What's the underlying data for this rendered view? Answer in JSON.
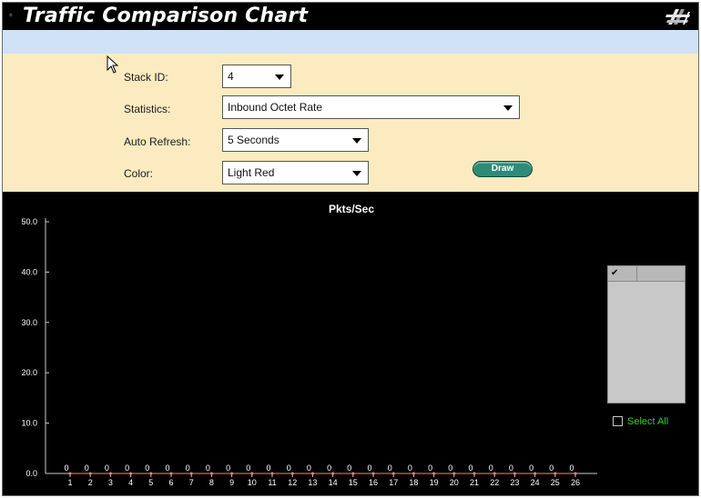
{
  "header": {
    "title": "Traffic Comparison Chart",
    "bullet": "◦",
    "logo_icon": "brand-logo-icon"
  },
  "controls": {
    "stack_id": {
      "label": "Stack ID:",
      "value": "4"
    },
    "statistics": {
      "label": "Statistics:",
      "value": "Inbound Octet Rate"
    },
    "auto_refresh": {
      "label": "Auto Refresh:",
      "value": "5 Seconds"
    },
    "color": {
      "label": "Color:",
      "value": "Light Red"
    },
    "draw_label": "Draw"
  },
  "colors": {
    "panel_bg": "#fcebc1",
    "blue_strip": "#cfe2f7",
    "chart_bg": "#000000",
    "draw_button": "#2f8a78",
    "select_all_text": "#27d62b"
  },
  "port_list": {
    "check_header": "✔",
    "select_all_label": "Select All"
  },
  "chart_data": {
    "type": "line",
    "title": "Pkts/Sec",
    "xlabel": "",
    "ylabel": "",
    "ylim": [
      0,
      50
    ],
    "yticks": [
      "0.0",
      "10.0",
      "20.0",
      "30.0",
      "40.0",
      "50.0"
    ],
    "categories": [
      "1",
      "2",
      "3",
      "4",
      "5",
      "6",
      "7",
      "8",
      "9",
      "10",
      "11",
      "12",
      "13",
      "14",
      "15",
      "16",
      "17",
      "18",
      "19",
      "20",
      "21",
      "22",
      "23",
      "24",
      "25",
      "26"
    ],
    "point_labels": [
      "0",
      "0",
      "0",
      "0",
      "0",
      "0",
      "0",
      "0",
      "0",
      "0",
      "0",
      "0",
      "0",
      "0",
      "0",
      "0",
      "0",
      "0",
      "0",
      "0",
      "0",
      "0",
      "0",
      "0",
      "0",
      "0"
    ],
    "values": [
      0,
      0,
      0,
      0,
      0,
      0,
      0,
      0,
      0,
      0,
      0,
      0,
      0,
      0,
      0,
      0,
      0,
      0,
      0,
      0,
      0,
      0,
      0,
      0,
      0,
      0
    ],
    "grid": false
  }
}
